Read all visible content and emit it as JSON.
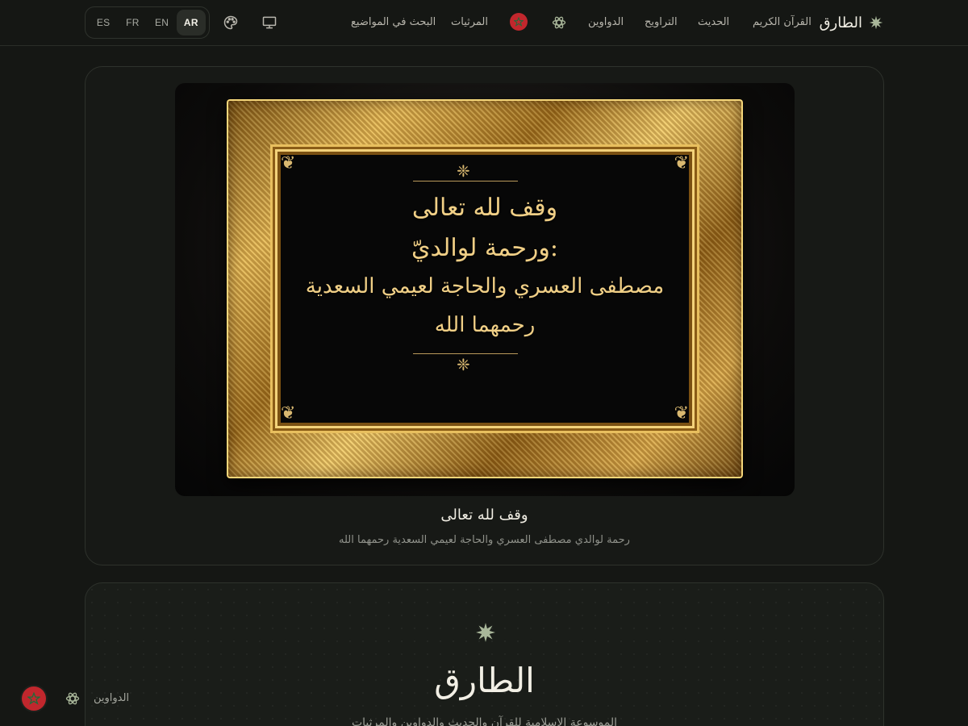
{
  "nav": {
    "brand": "الطارق",
    "links": {
      "quran": "القرآن الكريم",
      "hadith": "الحديث",
      "taraweeh": "التراويح",
      "dawawin": "الدواوين",
      "marathi": "المرثيات",
      "search": "البحث في المواضيع"
    },
    "languages": [
      "ES",
      "FR",
      "EN",
      "AR"
    ],
    "active_language": "AR",
    "icons": {
      "brand": "eight-point-star-icon",
      "atom": "atom-icon",
      "flag": "morocco-flag-icon",
      "presentation": "presentation-board-icon",
      "palette": "palette-icon"
    }
  },
  "hero": {
    "calligraphy": {
      "line1": "وقف لله تعالى",
      "line2": "ورحمة لوالديّ:",
      "line3": "مصطفى العسري والحاجة لعيمي السعدية",
      "line4": "رحمهما الله"
    },
    "caption_title": "وقف لله تعالى",
    "caption_subtitle": "رحمة لوالدي مصطفى العسري والحاجة لعيمي السعدية رحمهما الله"
  },
  "intro": {
    "title": "الطارق",
    "text": "الموسوعة الإسلامية للقرآن والحديث والدواوين والمرثيات"
  },
  "dock": {
    "label": "الدواوين"
  },
  "colors": {
    "background": "#151714",
    "card": "#171916",
    "border": "#2e322c",
    "accent_star": "#a9b79a",
    "gold": "#e6b955",
    "flag_red": "#c1272d",
    "flag_green": "#1f6b3a"
  }
}
